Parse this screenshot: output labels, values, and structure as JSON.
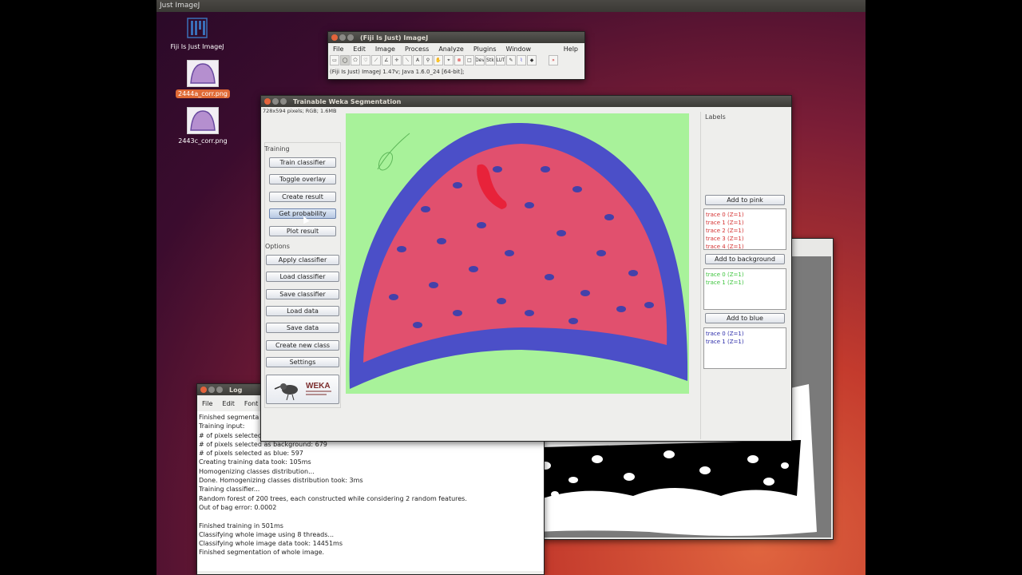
{
  "desktop": {
    "topbar_title": "Just ImageJ",
    "icons": [
      {
        "label": "Fiji Is Just ImageJ"
      },
      {
        "label": "2444a_corr.png"
      },
      {
        "label": "2443c_corr.png"
      }
    ]
  },
  "imagej_main": {
    "title": "(Fiji Is Just) ImageJ",
    "menu": [
      "File",
      "Edit",
      "Image",
      "Process",
      "Analyze",
      "Plugins",
      "Window",
      "Help"
    ],
    "tools": [
      "rect",
      "oval",
      "poly",
      "free",
      "line",
      "angle",
      "point",
      "wand",
      "text",
      "zoom",
      "hand",
      "dropper",
      "color",
      "box",
      "Dev",
      "Stk",
      "LUT",
      "pencil",
      "brush",
      "fill",
      "more"
    ],
    "tool_labels": {
      "dev": "Dev",
      "stk": "Stk",
      "lut": "LUT"
    },
    "status": "(Fiji Is Just) ImageJ 1.47v; Java 1.6.0_24 [64-bit];"
  },
  "weka": {
    "title": "Trainable Weka Segmentation",
    "image_info": "728x594 pixels; RGB; 1.6MB",
    "training_label": "Training",
    "training_buttons": [
      "Train classifier",
      "Toggle overlay",
      "Create result",
      "Get probability",
      "Plot result"
    ],
    "options_label": "Options",
    "options_buttons": [
      "Apply classifier",
      "Load classifier",
      "Save classifier",
      "Load data",
      "Save data",
      "Create new class",
      "Settings"
    ],
    "weka_logo_text": "WEKA",
    "labels_title": "Labels",
    "classes": [
      {
        "button": "Add to pink",
        "traces": [
          "trace 0 (Z=1)",
          "trace 1 (Z=1)",
          "trace 2 (Z=1)",
          "trace 3 (Z=1)",
          "trace 4 (Z=1)"
        ],
        "color": "#d43030"
      },
      {
        "button": "Add to background",
        "traces": [
          "trace 0 (Z=1)",
          "trace 1 (Z=1)"
        ],
        "color": "#3cc43c"
      },
      {
        "button": "Add to blue",
        "traces": [
          "trace 0 (Z=1)",
          "trace 1 (Z=1)"
        ],
        "color": "#2a2aa8"
      }
    ]
  },
  "log": {
    "title": "Log",
    "menu": [
      "File",
      "Edit",
      "Font"
    ],
    "lines": [
      "Finished segmenta",
      "Training input:",
      "# of pixels selected",
      "# of pixels selected as background: 679",
      "# of pixels selected as blue: 597",
      "Creating training data took: 105ms",
      "Homogenizing classes distribution...",
      "Done. Homogenizing classes distribution took: 3ms",
      "Training classifier...",
      "Random forest of 200 trees, each constructed while considering 2 random features.",
      "Out of bag error: 0.0002",
      "",
      "Finished training in 501ms",
      "Classifying whole image using 8 threads...",
      "Classifying whole image data took: 14451ms",
      "Finished segmentation of whole image."
    ]
  }
}
